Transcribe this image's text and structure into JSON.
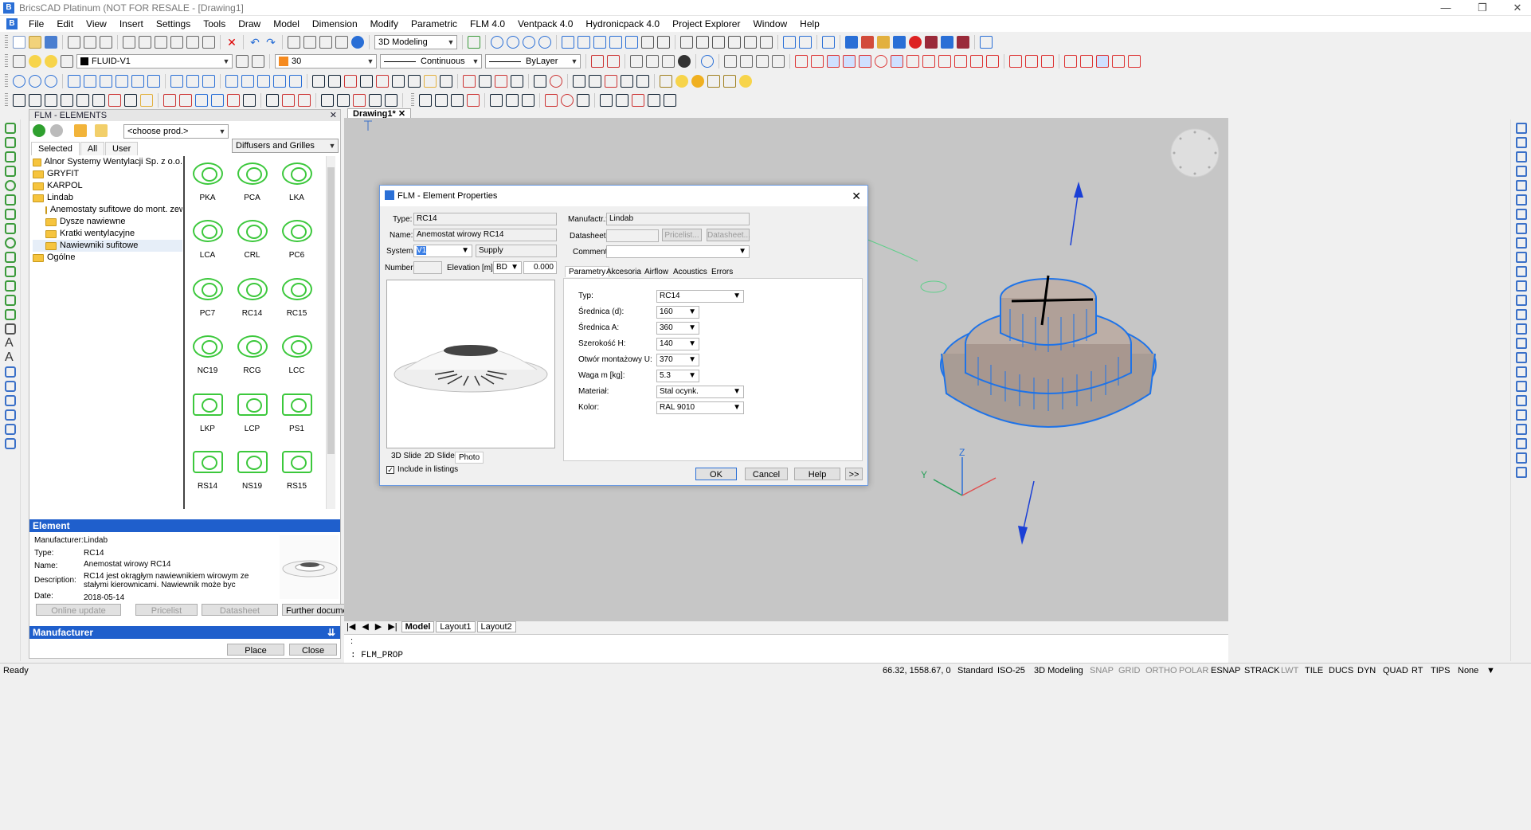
{
  "app": {
    "title": "BricsCAD Platinum (NOT FOR RESALE - [Drawing1]",
    "logo": "B"
  },
  "menu": [
    "File",
    "Edit",
    "View",
    "Insert",
    "Settings",
    "Tools",
    "Draw",
    "Model",
    "Dimension",
    "Modify",
    "Parametric",
    "FLM 4.0",
    "Ventpack 4.0",
    "Hydronicpack 4.0",
    "Project Explorer",
    "Window",
    "Help"
  ],
  "toolbar": {
    "workspace": "3D Modeling",
    "layer": "FLUID-V1",
    "color": "30",
    "linetype": "Continuous",
    "lineweight": "ByLayer"
  },
  "drawing_tab": "Drawing1*",
  "flm_panel": {
    "title": "FLM - ELEMENTS",
    "product_combo": "<choose prod.>",
    "category_combo": "Diffusers and Grilles",
    "tabs": [
      "Selected",
      "All",
      "User"
    ],
    "tree": [
      {
        "label": "Alnor Systemy Wentylacji Sp. z o.o.",
        "level": 0
      },
      {
        "label": "GRYFIT",
        "level": 0
      },
      {
        "label": "KARPOL",
        "level": 0
      },
      {
        "label": "Lindab",
        "level": 0
      },
      {
        "label": "Anemostaty sufitowe do mont. zew.",
        "level": 1
      },
      {
        "label": "Dysze nawiewne",
        "level": 1
      },
      {
        "label": "Kratki wentylacyjne",
        "level": 1
      },
      {
        "label": "Nawiewniki sufitowe",
        "level": 1
      },
      {
        "label": "Ogólne",
        "level": 0
      }
    ],
    "elements": [
      "PKA",
      "PCA",
      "LKA",
      "LCA",
      "CRL",
      "PC6",
      "PC7",
      "RC14",
      "RC15",
      "NC19",
      "RCG",
      "LCC",
      "LKP",
      "LCP",
      "PS1",
      "RS14",
      "NS19",
      "RS15"
    ],
    "element_section": {
      "header": "Element",
      "manufacturer_label": "Manufacturer:",
      "manufacturer": "Lindab",
      "type_label": "Type:",
      "type": "RC14",
      "name_label": "Name:",
      "name": "Anemostat wirowy RC14",
      "description_label": "Description:",
      "description": "RC14 jest okrągłym nawiewnikiem wirowym ze stałymi kierownicami. Nawiewnik może byc stosowany zarówno do",
      "date_label": "Date:",
      "date": "2018-05-14"
    },
    "buttons": {
      "online_update": "Online update",
      "pricelist": "Pricelist",
      "datasheet": "Datasheet",
      "further": "Further documents:"
    },
    "manufacturer_header": "Manufacturer",
    "place": "Place",
    "close": "Close"
  },
  "dialog": {
    "title": "FLM - Element Properties",
    "type_label": "Type:",
    "type": "RC14",
    "name_label": "Name:",
    "name": "Anemostat wirowy RC14",
    "system_label": "System:",
    "system": "V1",
    "system_kind": "Supply",
    "number_label": "Number:",
    "elevation_label": "Elevation [m]:",
    "elevation_ref": "BD",
    "elevation": "0.000",
    "manufacturer_label": "Manufactr.:",
    "manufacturer": "Lindab",
    "datasheet_label": "Datasheet:",
    "pricelist_btn": "Pricelist...",
    "datasheet_btn": "Datasheet...",
    "comment_label": "Comment:",
    "tabs": [
      "Parametry",
      "Akcesoria",
      "Airflow",
      "Acoustics",
      "Errors"
    ],
    "params": [
      {
        "label": "Typ:",
        "value": "RC14"
      },
      {
        "label": "Średnica (d):",
        "value": "160"
      },
      {
        "label": "Średnica A:",
        "value": "360"
      },
      {
        "label": "Szerokość H:",
        "value": "140"
      },
      {
        "label": "Otwór montażowy U:",
        "value": "370"
      },
      {
        "label": "Waga m [kg]:",
        "value": "5.3"
      },
      {
        "label": "Materiał:",
        "value": "Stal ocynk."
      },
      {
        "label": "Kolor:",
        "value": "RAL 9010"
      }
    ],
    "preview_tabs": [
      "3D Slide",
      "2D Slide",
      "Photo"
    ],
    "include_listings": "Include in listings",
    "ok": "OK",
    "cancel": "Cancel",
    "help": "Help",
    "more": ">>"
  },
  "layout_tabs": [
    "Model",
    "Layout1",
    "Layout2"
  ],
  "command": {
    "prompt": ":",
    "last": ":  FLM_PROP"
  },
  "status": {
    "ready": "Ready",
    "coords": "66.32, 1558.67, 0",
    "items": [
      "Standard",
      "ISO-25",
      "3D Modeling",
      "SNAP",
      "GRID",
      "ORTHO",
      "POLAR",
      "ESNAP",
      "STRACK",
      "LWT",
      "TILE",
      "DUCS",
      "DYN",
      "QUAD",
      "RT",
      "TIPS",
      "None"
    ]
  },
  "colors": {
    "accent": "#1f5fcc",
    "model": "#1e73e8",
    "element_green": "#3cc83c"
  },
  "axis_labels": {
    "z": "Z",
    "y": "Y"
  }
}
